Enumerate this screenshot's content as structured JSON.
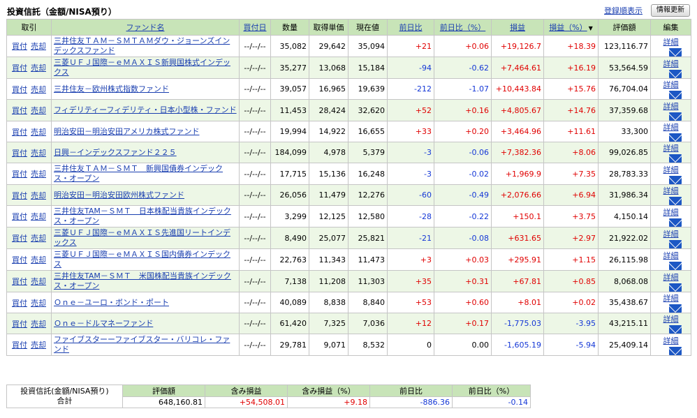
{
  "header": {
    "title": "投資信託（金額/NISA預り）",
    "register_order_link": "登録順表示",
    "refresh_button": "情報更新"
  },
  "columns": {
    "trade": "取引",
    "fund_name": "ファンド名",
    "buy_date": "買付日",
    "quantity": "数量",
    "unit_cost": "取得単価",
    "current_price": "現在値",
    "day_change": "前日比",
    "day_change_pct": "前日比（%）",
    "pnl": "損益",
    "pnl_pct": "損益（%）",
    "sort_indicator": "▼",
    "valuation": "評価額",
    "edit": "編集"
  },
  "labels": {
    "buy": "買付",
    "sell": "売却",
    "detail": "詳細"
  },
  "rows": [
    {
      "fund": "三井住友ＴＡＭ－ＳＭＴＡＭダウ・ジョーンズインデックスファンド",
      "date": "--/--/--",
      "qty": "35,082",
      "cost": "29,642",
      "price": "35,094",
      "chg": "+21",
      "chg_pct": "+0.06",
      "pnl": "+19,126.7",
      "pnl_pct": "+18.39",
      "val": "123,116.77"
    },
    {
      "fund": "三菱ＵＦＪ国際－ｅＭＡＸＩＳ新興国株式インデックス",
      "date": "--/--/--",
      "qty": "35,277",
      "cost": "13,068",
      "price": "15,184",
      "chg": "-94",
      "chg_pct": "-0.62",
      "pnl": "+7,464.61",
      "pnl_pct": "+16.19",
      "val": "53,564.59"
    },
    {
      "fund": "三井住友－欧州株式指数ファンド",
      "date": "--/--/--",
      "qty": "39,057",
      "cost": "16,965",
      "price": "19,639",
      "chg": "-212",
      "chg_pct": "-1.07",
      "pnl": "+10,443.84",
      "pnl_pct": "+15.76",
      "val": "76,704.04"
    },
    {
      "fund": "フィデリティーフィデリティ・日本小型株・ファンド",
      "date": "--/--/--",
      "qty": "11,453",
      "cost": "28,424",
      "price": "32,620",
      "chg": "+52",
      "chg_pct": "+0.16",
      "pnl": "+4,805.67",
      "pnl_pct": "+14.76",
      "val": "37,359.68"
    },
    {
      "fund": "明治安田－明治安田アメリカ株式ファンド",
      "date": "--/--/--",
      "qty": "19,994",
      "cost": "14,922",
      "price": "16,655",
      "chg": "+33",
      "chg_pct": "+0.20",
      "pnl": "+3,464.96",
      "pnl_pct": "+11.61",
      "val": "33,300"
    },
    {
      "fund": "日興－インデックスファンド２２５",
      "date": "--/--/--",
      "qty": "184,099",
      "cost": "4,978",
      "price": "5,379",
      "chg": "-3",
      "chg_pct": "-0.06",
      "pnl": "+7,382.36",
      "pnl_pct": "+8.06",
      "val": "99,026.85"
    },
    {
      "fund": "三井住友ＴＡＭ－ＳＭＴ　新興国債券インデックス・オープン",
      "date": "--/--/--",
      "qty": "17,715",
      "cost": "15,136",
      "price": "16,248",
      "chg": "-3",
      "chg_pct": "-0.02",
      "pnl": "+1,969.9",
      "pnl_pct": "+7.35",
      "val": "28,783.33"
    },
    {
      "fund": "明治安田－明治安田欧州株式ファンド",
      "date": "--/--/--",
      "qty": "26,056",
      "cost": "11,479",
      "price": "12,276",
      "chg": "-60",
      "chg_pct": "-0.49",
      "pnl": "+2,076.66",
      "pnl_pct": "+6.94",
      "val": "31,986.34"
    },
    {
      "fund": "三井住友TAM－ＳＭＴ　日本株配当貴族インデックス・オープン",
      "date": "--/--/--",
      "qty": "3,299",
      "cost": "12,125",
      "price": "12,580",
      "chg": "-28",
      "chg_pct": "-0.22",
      "pnl": "+150.1",
      "pnl_pct": "+3.75",
      "val": "4,150.14"
    },
    {
      "fund": "三菱ＵＦＪ国際－ｅＭＡＸＩＳ先進国リートインデックス",
      "date": "--/--/--",
      "qty": "8,490",
      "cost": "25,077",
      "price": "25,821",
      "chg": "-21",
      "chg_pct": "-0.08",
      "pnl": "+631.65",
      "pnl_pct": "+2.97",
      "val": "21,922.02"
    },
    {
      "fund": "三菱ＵＦＪ国際－ｅＭＡＸＩＳ国内債券インデックス",
      "date": "--/--/--",
      "qty": "22,763",
      "cost": "11,343",
      "price": "11,473",
      "chg": "+3",
      "chg_pct": "+0.03",
      "pnl": "+295.91",
      "pnl_pct": "+1.15",
      "val": "26,115.98"
    },
    {
      "fund": "三井住友TAM－ＳＭＴ　米国株配当貴族インデックス・オープン",
      "date": "--/--/--",
      "qty": "7,138",
      "cost": "11,208",
      "price": "11,303",
      "chg": "+35",
      "chg_pct": "+0.31",
      "pnl": "+67.81",
      "pnl_pct": "+0.85",
      "val": "8,068.08"
    },
    {
      "fund": "Ｏｎｅ－ユーロ・ボンド・ポート",
      "date": "--/--/--",
      "qty": "40,089",
      "cost": "8,838",
      "price": "8,840",
      "chg": "+53",
      "chg_pct": "+0.60",
      "pnl": "+8.01",
      "pnl_pct": "+0.02",
      "val": "35,438.67"
    },
    {
      "fund": "Ｏｎｅ－ドルマネーファンド",
      "date": "--/--/--",
      "qty": "61,420",
      "cost": "7,325",
      "price": "7,036",
      "chg": "+12",
      "chg_pct": "+0.17",
      "pnl": "-1,775.03",
      "pnl_pct": "-3.95",
      "val": "43,215.11"
    },
    {
      "fund": "ファイブスターーファイブスター・バリコレ・ファンド",
      "date": "--/--/--",
      "qty": "29,781",
      "cost": "9,071",
      "price": "8,532",
      "chg": "0",
      "chg_pct": "0.00",
      "pnl": "-1,605.19",
      "pnl_pct": "-5.94",
      "val": "25,409.14"
    }
  ],
  "summary": {
    "label_line1": "投資信託(金額/NISA預り)",
    "label_line2": "合計",
    "headers": {
      "valuation": "評価額",
      "unrealized_pnl": "含み損益",
      "unrealized_pnl_pct": "含み損益（%）",
      "day_change": "前日比",
      "day_change_pct": "前日比（%）"
    },
    "values": {
      "valuation": "648,160.81",
      "unrealized_pnl": "+54,508.01",
      "unrealized_pnl_pct": "+9.18",
      "day_change": "-886.36",
      "day_change_pct": "-0.14"
    }
  },
  "colors": {
    "header_bg": "#c8e4b8",
    "alt_row_bg": "#edf7e6",
    "positive": "#e00000",
    "negative": "#1437d6",
    "link": "#1a3fb0"
  }
}
